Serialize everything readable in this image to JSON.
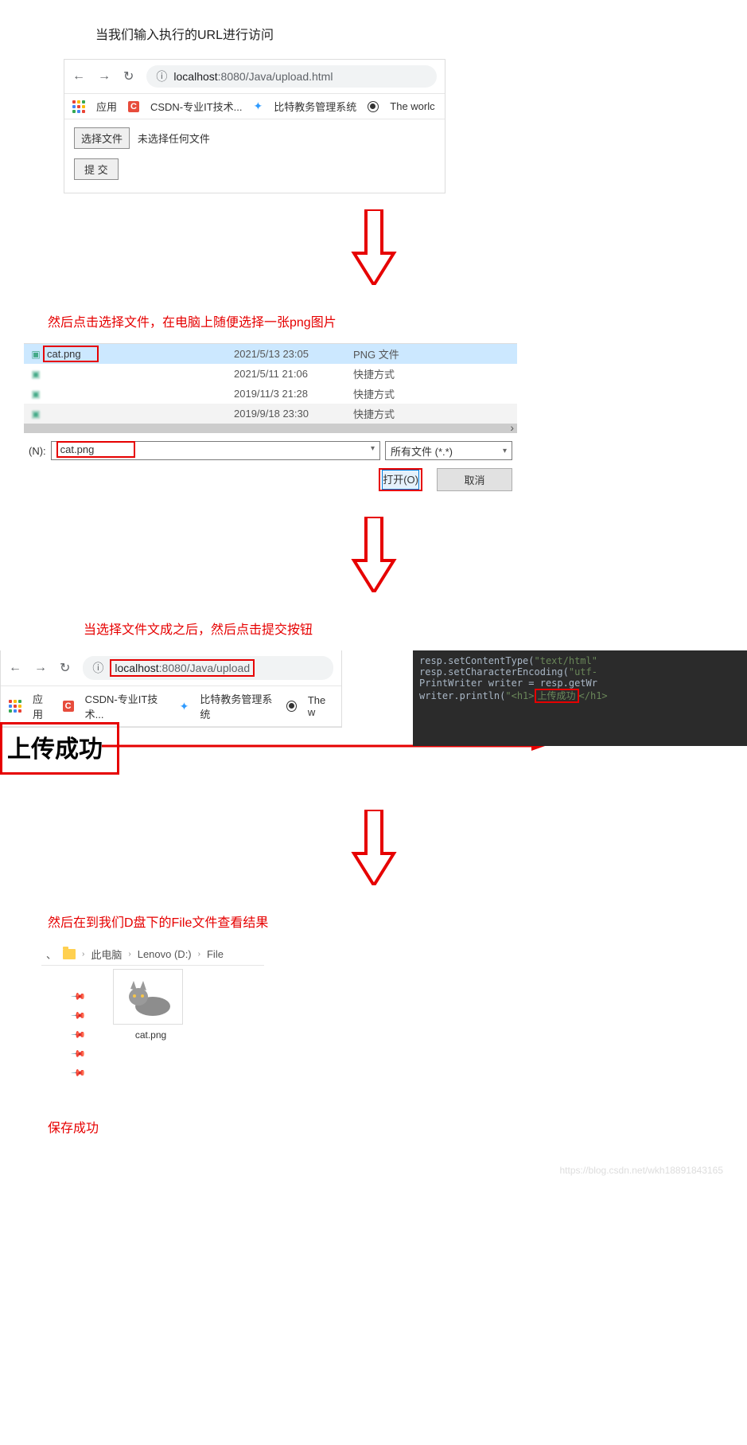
{
  "step1": {
    "caption": "当我们输入执行的URL进行访问",
    "url_host": "localhost",
    "url_port_path": ":8080/Java/upload.html",
    "apps_label": "应用",
    "bm_csdn": "CSDN-专业IT技术...",
    "bm_bit": "比特教务管理系统",
    "bm_world": "The worlc",
    "choose_file": "选择文件",
    "no_file": "未选择任何文件",
    "submit": "提 交"
  },
  "step2_caption": "然后点击选择文件，在电脑上随便选择一张png图片",
  "dialog": {
    "rows": [
      {
        "name": "cat.png",
        "date": "2021/5/13 23:05",
        "type": "PNG 文件",
        "selected": true
      },
      {
        "name": " ",
        "date": "2021/5/11 21:06",
        "type": "快捷方式",
        "selected": false
      },
      {
        "name": " ",
        "date": "2019/11/3 21:28",
        "type": "快捷方式",
        "selected": false
      },
      {
        "name": " ",
        "date": "2019/9/18 23:30",
        "type": "快捷方式",
        "selected": false
      }
    ],
    "filename_label": "(N):",
    "filename_value": "cat.png",
    "filter": "所有文件 (*.*)",
    "open": "打开(O)",
    "cancel": "取消"
  },
  "step3_caption": "当选择文件文成之后，然后点击提交按钮",
  "step3": {
    "url_host": "localhost",
    "url_port_path": ":8080/Java/upload",
    "apps_label": "应用",
    "bm_csdn": "CSDN-专业IT技术...",
    "bm_bit": "比特教务管理系统",
    "bm_world": "The w",
    "success_text": "上传成功"
  },
  "code": {
    "l1a": "resp.setContentType(",
    "l1b": "\"text/html\"",
    "l2a": "resp.setCharacterEncoding(",
    "l2b": "\"utf-",
    "l3a": "PrintWriter writer = resp.getWr",
    "l4a": "writer.println(",
    "l4b": "\"<h1>",
    "l4c": "上传成功",
    "l4d": "</h1>"
  },
  "step4_caption": "然后在到我们D盘下的File文件查看结果",
  "explorer": {
    "crumb_pc": "此电脑",
    "crumb_drive": "Lenovo (D:)",
    "crumb_folder": "File",
    "file_name": "cat.png"
  },
  "final_caption": "保存成功",
  "watermark": "https://blog.csdn.net/wkh18891843165"
}
